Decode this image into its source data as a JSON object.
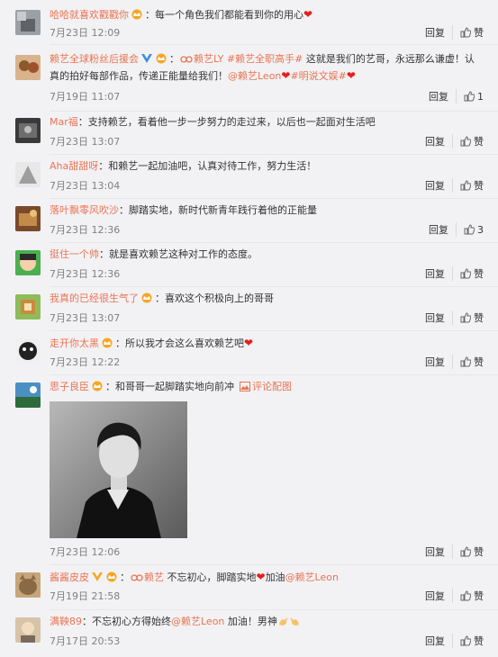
{
  "colors": {
    "username": "#eb7350",
    "meta": "#808080",
    "background": "#f2f2f5"
  },
  "actions": {
    "reply_label": "回复",
    "like_label": "赞"
  },
  "comments": [
    {
      "username": "哈哈就喜欢戳戳你",
      "text": "：每一个角色我们都能看到你的用心",
      "date": "7月23日 12:09",
      "likes": "赞"
    },
    {
      "username": "赖艺全球粉丝后援会",
      "tag1": "赖艺LY",
      "tag2": "#赖艺全职高手#",
      "text1": " 这就是我们的艺哥，永远那么谦虚！认",
      "text2": "真的拍好每部作品，传递正能量给我们！",
      "mention": "@赖艺Leon",
      "topic": "#明说文娱#",
      "date": "7月19日 11:07",
      "likes": "1"
    },
    {
      "username": "Mar福",
      "text": "：支持赖艺，看着他一步一步努力的走过来，以后也一起面对生活吧",
      "date": "7月23日 13:07",
      "likes": "赞"
    },
    {
      "username": "Aha甜甜呀",
      "text": "：和赖艺一起加油吧，认真对待工作，努力生活！",
      "date": "7月23日 13:04",
      "likes": "赞"
    },
    {
      "username": "落叶飘零风吹沙",
      "text": "：脚踏实地，新时代新青年践行着他的正能量",
      "date": "7月23日 12:36",
      "likes": "3"
    },
    {
      "username": "挺住一个帅",
      "text": "：就是喜欢赖艺这种对工作的态度。",
      "date": "7月23日 12:36",
      "likes": "赞"
    },
    {
      "username": "我真的已经很生气了",
      "text": "：喜欢这个积极向上的哥哥",
      "date": "7月23日 13:07",
      "likes": "赞"
    },
    {
      "username": "走开你太黑",
      "text": "：所以我才会这么喜欢赖艺吧",
      "date": "7月23日 12:22",
      "likes": "赞"
    },
    {
      "username": "思子良臣",
      "text": "：和哥哥一起脚踏实地向前冲",
      "pic_label": "评论配图",
      "date": "7月23日 12:06",
      "likes": "赞"
    },
    {
      "username": "酱酱皮皮",
      "tag1": "赖艺",
      "text": " 不忘初心，脚踏实地",
      "text2": "加油",
      "mention": "@赖艺Leon",
      "date": "7月19日 21:58",
      "likes": "赞"
    },
    {
      "username": "满鞅89",
      "text": "：不忘初心方得始终",
      "mention": "@赖艺Leon",
      "text2": " 加油！男神",
      "date": "7月17日 20:53",
      "likes": "赞"
    }
  ]
}
